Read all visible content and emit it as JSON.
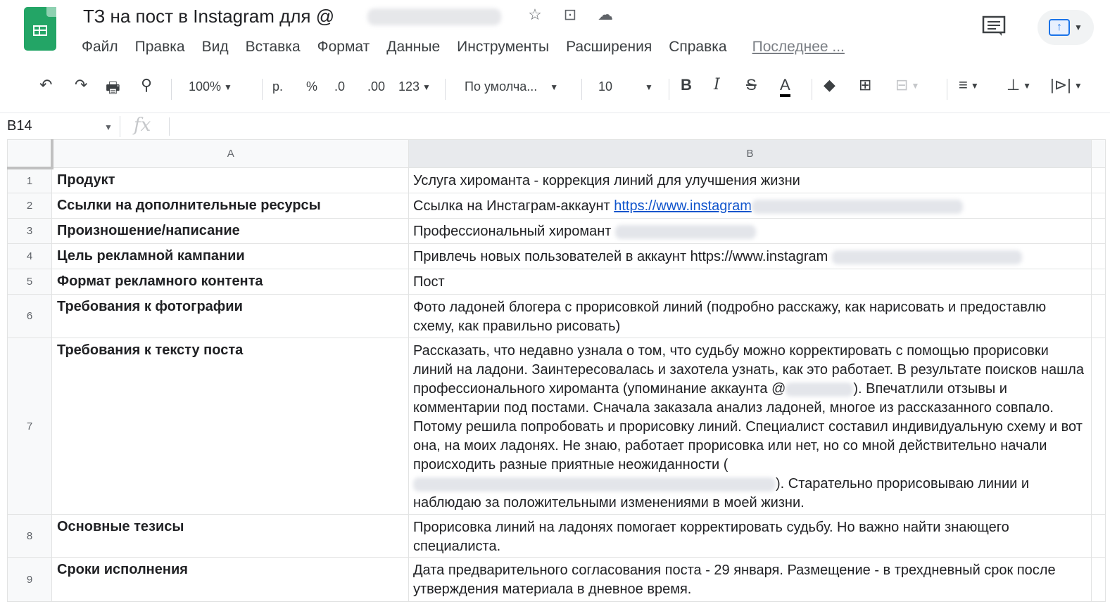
{
  "app": {
    "title": "ТЗ на пост в Instagram для @",
    "icons": {
      "star": "☆",
      "move": "⊡",
      "cloud": "☁"
    }
  },
  "menu": [
    "Файл",
    "Правка",
    "Вид",
    "Вставка",
    "Формат",
    "Данные",
    "Инструменты",
    "Расширения",
    "Справка"
  ],
  "last_edit": "Последнее ...",
  "toolbar": {
    "undo": "↶",
    "redo": "↷",
    "print": "🖶",
    "paint_format": "⚲",
    "zoom": "100%",
    "currency": "р.",
    "percent": "%",
    "dec_decrease": ".0",
    "dec_increase": ".00",
    "more_formats": "123",
    "font": "По умолча...",
    "font_size": "10",
    "bold": "B",
    "italic": "I",
    "strike": "S",
    "text_color": "A",
    "fill": "◆",
    "borders": "⊞",
    "merge": "⊟",
    "align": "≡",
    "valign": "⊥",
    "wrap": "|⊳|"
  },
  "formula_bar": {
    "cell_ref": "B14",
    "fx": "fx"
  },
  "columns": [
    "A",
    "B"
  ],
  "rows": [
    {
      "num": "1",
      "a": "Продукт",
      "b": "Услуга хироманта - коррекция линий для улучшения жизни"
    },
    {
      "num": "2",
      "a": "Ссылки на дополнительные ресурсы",
      "b_prefix": "Ссылка на Инстаграм-аккаунт ",
      "b_link": "https://www.instagram"
    },
    {
      "num": "3",
      "a": "Произношение/написание",
      "b": "Профессиональный хиромант"
    },
    {
      "num": "4",
      "a": "Цель рекламной кампании",
      "b": "Привлечь новых пользователей в аккаунт https://www.instagram"
    },
    {
      "num": "5",
      "a": "Формат рекламного контента",
      "b": "Пост"
    },
    {
      "num": "6",
      "a": "Требования к фотографии",
      "b": "Фото ладоней блогера с прорисовкой линий (подробно расскажу, как нарисовать и предоставлю схему, как правильно рисовать)"
    },
    {
      "num": "7",
      "a": "Требования к тексту поста",
      "b_part1": "Рассказать, что недавно узнала о том, что судьбу можно корректировать с помощью прорисовки линий на ладони. Заинтересовалась и захотела узнать, как это работает. В результате поисков нашла профессионального хироманта (упоминание аккаунта @",
      "b_part2": "). Впечатлили отзывы и комментарии под постами. Сначала заказала анализ ладоней, многое из рассказанного совпало. Потому решила попробовать и прорисовку линий. Специалист составил индивидуальную схему и вот она, на моих ладонях. Не знаю, работает прорисовка или нет, но со мной действительно начали происходить разные приятные неожиданности (",
      "b_part3": "). Старательно прорисовываю линии и наблюдаю за положительными изменениями в моей жизни."
    },
    {
      "num": "8",
      "a": "Основные тезисы",
      "b": "Прорисовка линий на ладонях помогает корректировать судьбу. Но важно найти знающего специалиста."
    },
    {
      "num": "9",
      "a": "Сроки исполнения",
      "b": "Дата предварительного согласования поста - 29 января. Размещение - в трехдневный срок после утверждения материала в дневное время."
    }
  ]
}
